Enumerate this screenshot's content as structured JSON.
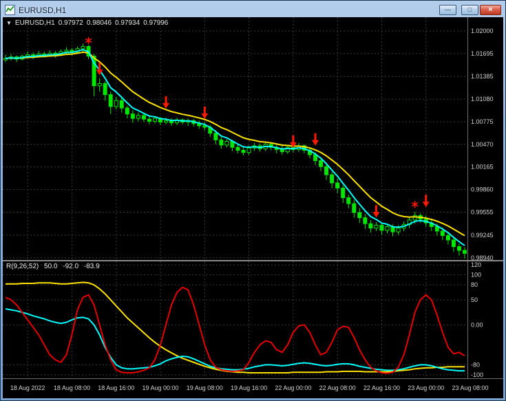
{
  "window": {
    "title": "EURUSD,H1",
    "controls": {
      "minimize": "—",
      "maximize": "□",
      "close": "×"
    }
  },
  "chart": {
    "symbol_label": "EURUSD,H1",
    "ohlc": {
      "open": "0.97972",
      "high": "0.98046",
      "low": "0.97934",
      "close": "0.97996"
    },
    "price_axis": [
      "1.02000",
      "1.01695",
      "1.01385",
      "1.01080",
      "1.00775",
      "1.00470",
      "1.00165",
      "0.99860",
      "0.99555",
      "0.99245",
      "0.98940"
    ],
    "time_axis": [
      "18 Aug 2022",
      "18 Aug 08:00",
      "18 Aug 16:00",
      "19 Aug 00:00",
      "19 Aug 08:00",
      "19 Aug 16:00",
      "22 Aug 00:00",
      "22 Aug 08:00",
      "22 Aug 16:00",
      "23 Aug 00:00",
      "23 Aug 08:00"
    ]
  },
  "indicator": {
    "label": "R(9,26,52)",
    "values": [
      "50.0",
      "-92.0",
      "-83.9"
    ],
    "axis": [
      "120",
      "100",
      "80",
      "50",
      "0.00",
      "-80",
      "-100"
    ]
  },
  "chart_data": [
    {
      "type": "candlestick",
      "title": "EURUSD H1 price pane",
      "ylim": [
        0.9891,
        1.02185
      ],
      "price_gridlines": [
        1.02,
        1.01695,
        1.01385,
        1.0108,
        1.00775,
        1.0047,
        1.00165,
        0.9986,
        0.99555,
        0.99245,
        0.9894
      ],
      "x_gridline_bars": [
        4,
        12,
        20,
        28,
        36,
        44,
        52,
        60,
        68,
        76,
        84
      ],
      "colors": {
        "bull": "#000000",
        "bear": "#00e600",
        "outline": "#00e600",
        "grid": "#3a3a3a",
        "signal": "#ff1a00"
      },
      "overlays": [
        {
          "name": "ma-slow-yellow",
          "type": "ema",
          "period": 12,
          "color": "#ffe400"
        },
        {
          "name": "ma-fast-cyan",
          "type": "ema",
          "period": 5,
          "color": "#00ffff"
        }
      ],
      "signals": {
        "arrows_down": [
          {
            "bar": 17,
            "price": 1.0157
          },
          {
            "bar": 29,
            "price": 1.0112
          },
          {
            "bar": 36,
            "price": 1.0098
          },
          {
            "bar": 52,
            "price": 1.0059
          },
          {
            "bar": 56,
            "price": 1.0062
          },
          {
            "bar": 67,
            "price": 0.9965
          },
          {
            "bar": 76,
            "price": 0.9979
          }
        ],
        "stars": [
          {
            "bar": 15,
            "price": 1.0187
          },
          {
            "bar": 74,
            "price": 0.9966
          }
        ]
      },
      "candles": [
        [
          1.0161,
          1.0168,
          1.0158,
          1.0163
        ],
        [
          1.0163,
          1.0169,
          1.016,
          1.0165
        ],
        [
          1.0165,
          1.0167,
          1.0158,
          1.0162
        ],
        [
          1.0162,
          1.0168,
          1.016,
          1.0166
        ],
        [
          1.0166,
          1.0172,
          1.0163,
          1.0168
        ],
        [
          1.0168,
          1.0171,
          1.0162,
          1.0166
        ],
        [
          1.0166,
          1.0173,
          1.0164,
          1.0169
        ],
        [
          1.0169,
          1.0172,
          1.0164,
          1.0167
        ],
        [
          1.0167,
          1.0174,
          1.0165,
          1.017
        ],
        [
          1.017,
          1.0173,
          1.0164,
          1.0168
        ],
        [
          1.0168,
          1.0175,
          1.0166,
          1.0172
        ],
        [
          1.0172,
          1.0178,
          1.0169,
          1.0174
        ],
        [
          1.0174,
          1.0177,
          1.0167,
          1.0171
        ],
        [
          1.0171,
          1.0179,
          1.0169,
          1.0176
        ],
        [
          1.0176,
          1.0183,
          1.0172,
          1.0179
        ],
        [
          1.0179,
          1.0181,
          1.0162,
          1.0166
        ],
        [
          1.0166,
          1.0169,
          1.0112,
          1.0126
        ],
        [
          1.0126,
          1.0136,
          1.0118,
          1.0129
        ],
        [
          1.0129,
          1.0132,
          1.0106,
          1.0114
        ],
        [
          1.0114,
          1.0118,
          1.0088,
          1.0098
        ],
        [
          1.0098,
          1.0111,
          1.0094,
          1.0106
        ],
        [
          1.0106,
          1.0109,
          1.009,
          1.0096
        ],
        [
          1.0096,
          1.0099,
          1.0082,
          1.0088
        ],
        [
          1.0088,
          1.0093,
          1.0076,
          1.0082
        ],
        [
          1.0082,
          1.009,
          1.0078,
          1.0086
        ],
        [
          1.0086,
          1.0089,
          1.0077,
          1.0081
        ],
        [
          1.0081,
          1.0085,
          1.0074,
          1.0078
        ],
        [
          1.0078,
          1.0085,
          1.0075,
          1.0082
        ],
        [
          1.0082,
          1.0084,
          1.0073,
          1.0077
        ],
        [
          1.0077,
          1.0083,
          1.0074,
          1.0079
        ],
        [
          1.0079,
          1.0082,
          1.0072,
          1.0076
        ],
        [
          1.0076,
          1.0083,
          1.0073,
          1.008
        ],
        [
          1.008,
          1.0082,
          1.0074,
          1.0077
        ],
        [
          1.0077,
          1.0082,
          1.0072,
          1.0079
        ],
        [
          1.0079,
          1.0081,
          1.0071,
          1.0075
        ],
        [
          1.0075,
          1.0079,
          1.0068,
          1.0072
        ],
        [
          1.0072,
          1.0077,
          1.0066,
          1.007
        ],
        [
          1.007,
          1.0073,
          1.0057,
          1.0062
        ],
        [
          1.0062,
          1.0066,
          1.0047,
          1.0053
        ],
        [
          1.0053,
          1.0057,
          1.0041,
          1.0046
        ],
        [
          1.0046,
          1.0054,
          1.0043,
          1.0051
        ],
        [
          1.0051,
          1.0053,
          1.0038,
          1.0043
        ],
        [
          1.0043,
          1.0047,
          1.0035,
          1.0039
        ],
        [
          1.0039,
          1.0045,
          1.0032,
          1.0036
        ],
        [
          1.0036,
          1.0045,
          1.0033,
          1.0042
        ],
        [
          1.0042,
          1.0049,
          1.0038,
          1.0045
        ],
        [
          1.0045,
          1.0048,
          1.0037,
          1.0041
        ],
        [
          1.0041,
          1.005,
          1.0038,
          1.0047
        ],
        [
          1.0047,
          1.005,
          1.0039,
          1.0043
        ],
        [
          1.0043,
          1.0047,
          1.0035,
          1.004
        ],
        [
          1.004,
          1.0045,
          1.0033,
          1.0037
        ],
        [
          1.0037,
          1.0046,
          1.0034,
          1.0043
        ],
        [
          1.0043,
          1.0046,
          1.0036,
          1.004
        ],
        [
          1.004,
          1.0049,
          1.0037,
          1.0045
        ],
        [
          1.0045,
          1.0047,
          1.0035,
          1.0039
        ],
        [
          1.0039,
          1.0042,
          1.0028,
          1.0033
        ],
        [
          1.0033,
          1.0036,
          1.0019,
          1.0025
        ],
        [
          1.0025,
          1.0029,
          1.0011,
          1.0017
        ],
        [
          1.0017,
          1.0021,
          0.9999,
          1.0006
        ],
        [
          1.0006,
          1.001,
          0.9988,
          0.9995
        ],
        [
          0.9995,
          1.0001,
          0.9981,
          0.9988
        ],
        [
          0.9988,
          0.9992,
          0.9968,
          0.9975
        ],
        [
          0.9975,
          0.9979,
          0.9961,
          0.9967
        ],
        [
          0.9967,
          0.9972,
          0.9948,
          0.9955
        ],
        [
          0.9955,
          0.9961,
          0.9941,
          0.9948
        ],
        [
          0.9948,
          0.9953,
          0.9933,
          0.994
        ],
        [
          0.994,
          0.9945,
          0.9928,
          0.9934
        ],
        [
          0.9934,
          0.9942,
          0.993,
          0.9938
        ],
        [
          0.9938,
          0.9941,
          0.9925,
          0.9931
        ],
        [
          0.9931,
          0.994,
          0.9927,
          0.9936
        ],
        [
          0.9936,
          0.9939,
          0.9923,
          0.9929
        ],
        [
          0.9929,
          0.9938,
          0.9925,
          0.9934
        ],
        [
          0.9934,
          0.9943,
          0.993,
          0.9939
        ],
        [
          0.9939,
          0.9949,
          0.9934,
          0.9945
        ],
        [
          0.9945,
          0.9956,
          0.994,
          0.9951
        ],
        [
          0.9951,
          0.9954,
          0.9941,
          0.9946
        ],
        [
          0.9946,
          0.9951,
          0.9936,
          0.9941
        ],
        [
          0.9941,
          0.9945,
          0.993,
          0.9936
        ],
        [
          0.9936,
          0.994,
          0.9924,
          0.993
        ],
        [
          0.993,
          0.9935,
          0.9918,
          0.9924
        ],
        [
          0.9924,
          0.9929,
          0.9912,
          0.9918
        ],
        [
          0.9918,
          0.9922,
          0.9902,
          0.9909
        ],
        [
          0.9909,
          0.9913,
          0.9897,
          0.9904
        ],
        [
          0.9904,
          0.9908,
          0.9893,
          0.99
        ]
      ]
    },
    {
      "type": "line",
      "title": "R(9,26,52) oscillator pane",
      "ylim": [
        -107,
        127
      ],
      "levels": [
        120,
        100,
        80,
        50,
        0,
        -80,
        -100
      ],
      "level_labels": [
        "120",
        "100",
        "80",
        "50",
        "0.00",
        "-80",
        "-100"
      ],
      "series": [
        {
          "name": "yellow",
          "color": "#ffe400",
          "values": [
            82,
            82,
            82,
            83,
            83,
            83,
            84,
            84,
            84,
            83,
            82,
            82,
            83,
            84,
            85,
            84,
            80,
            72,
            62,
            50,
            38,
            26,
            14,
            4,
            -6,
            -16,
            -26,
            -35,
            -43,
            -50,
            -56,
            -62,
            -67,
            -71,
            -75,
            -79,
            -83,
            -86,
            -89,
            -91,
            -93,
            -94,
            -95,
            -95,
            -96,
            -96,
            -96,
            -96,
            -96,
            -96,
            -96,
            -96,
            -95,
            -95,
            -95,
            -95,
            -95,
            -95,
            -94,
            -94,
            -94,
            -93,
            -93,
            -93,
            -93,
            -94,
            -94,
            -94,
            -94,
            -94,
            -93,
            -92,
            -91,
            -90,
            -88,
            -87,
            -86,
            -86,
            -85,
            -85,
            -84,
            -84,
            -84,
            -84
          ]
        },
        {
          "name": "cyan",
          "color": "#00ffff",
          "values": [
            32,
            30,
            28,
            25,
            22,
            18,
            15,
            12,
            8,
            5,
            3,
            5,
            10,
            14,
            15,
            12,
            0,
            -20,
            -45,
            -65,
            -80,
            -86,
            -88,
            -88,
            -87,
            -86,
            -85,
            -82,
            -78,
            -72,
            -68,
            -65,
            -63,
            -64,
            -68,
            -73,
            -78,
            -83,
            -86,
            -88,
            -89,
            -90,
            -90,
            -89,
            -87,
            -84,
            -82,
            -80,
            -80,
            -81,
            -82,
            -81,
            -79,
            -77,
            -76,
            -77,
            -79,
            -81,
            -82,
            -81,
            -79,
            -78,
            -78,
            -80,
            -83,
            -85,
            -87,
            -89,
            -90,
            -91,
            -91,
            -90,
            -88,
            -85,
            -82,
            -80,
            -80,
            -82,
            -85,
            -88,
            -90,
            -91,
            -92,
            -92
          ]
        },
        {
          "name": "red",
          "color": "#e80000",
          "values": [
            55,
            50,
            40,
            25,
            10,
            -5,
            -20,
            -40,
            -60,
            -70,
            -75,
            -60,
            -20,
            30,
            55,
            60,
            40,
            0,
            -40,
            -70,
            -90,
            -95,
            -96,
            -96,
            -94,
            -91,
            -86,
            -70,
            -40,
            0,
            40,
            65,
            75,
            70,
            40,
            0,
            -40,
            -70,
            -85,
            -90,
            -92,
            -93,
            -92,
            -90,
            -75,
            -55,
            -40,
            -32,
            -35,
            -50,
            -55,
            -40,
            -15,
            -2,
            0,
            -15,
            -40,
            -60,
            -55,
            -35,
            -10,
            -3,
            -5,
            -25,
            -50,
            -70,
            -85,
            -92,
            -96,
            -97,
            -95,
            -85,
            -60,
            -20,
            25,
            50,
            60,
            50,
            20,
            -15,
            -45,
            -58,
            -55,
            -62
          ]
        }
      ]
    }
  ]
}
